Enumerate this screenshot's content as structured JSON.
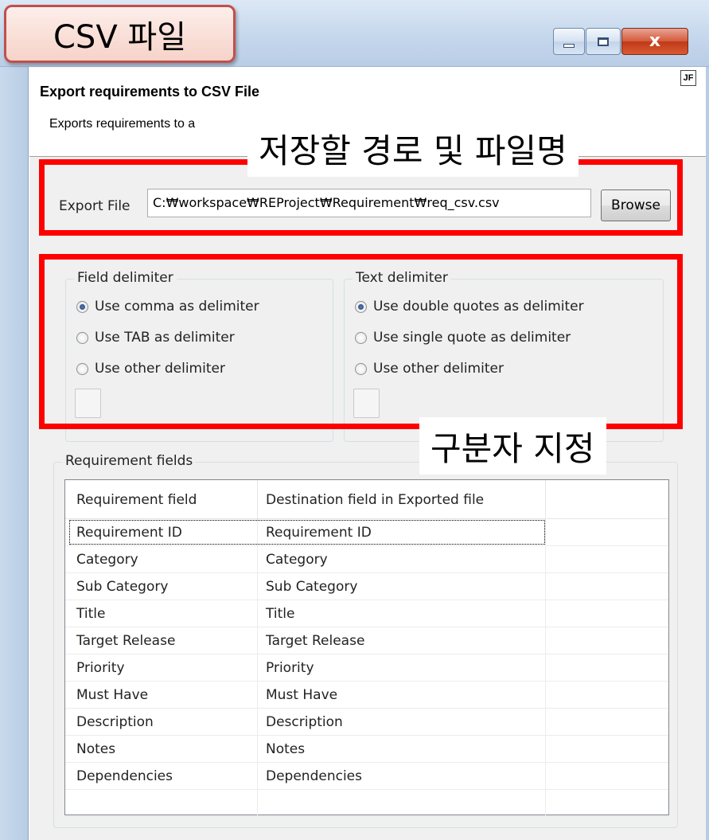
{
  "annotations": {
    "callout_title": "CSV 파일",
    "export_path_label": "저장할 경로 및 파일명",
    "delimiter_label": "구분자 지정"
  },
  "window": {
    "minimize_glyph": "",
    "close_glyph": "x"
  },
  "header": {
    "title": "Export requirements to CSV File",
    "description": "Exports requirements to a",
    "icon_text": "JF"
  },
  "export_file": {
    "label": "Export File",
    "value": "C:\\workspace\\REProject\\Requirement\\req_csv.csv",
    "display_value": "C:₩workspace₩REProject₩Requirement₩req_csv.csv",
    "browse_label": "Browse"
  },
  "field_delimiter": {
    "legend": "Field delimiter",
    "options": [
      {
        "label": "Use comma as delimiter",
        "checked": true
      },
      {
        "label": "Use TAB as delimiter",
        "checked": false
      },
      {
        "label": "Use other delimiter",
        "checked": false
      }
    ],
    "other_value": ""
  },
  "text_delimiter": {
    "legend": "Text delimiter",
    "options": [
      {
        "label": "Use double quotes as delimiter",
        "checked": true
      },
      {
        "label": "Use single quote as delimiter",
        "checked": false
      },
      {
        "label": "Use other delimiter",
        "checked": false
      }
    ],
    "other_value": ""
  },
  "requirement_fields": {
    "legend": "Requirement fields",
    "columns": [
      "Requirement field",
      "Destination field in Exported file"
    ],
    "rows": [
      {
        "field": "Requirement ID",
        "destination": "Requirement ID"
      },
      {
        "field": "Category",
        "destination": "Category"
      },
      {
        "field": "Sub Category",
        "destination": "Sub Category"
      },
      {
        "field": "Title",
        "destination": "Title"
      },
      {
        "field": "Target Release",
        "destination": "Target Release"
      },
      {
        "field": "Priority",
        "destination": "Priority"
      },
      {
        "field": "Must Have",
        "destination": "Must Have"
      },
      {
        "field": "Description",
        "destination": "Description"
      },
      {
        "field": "Notes",
        "destination": "Notes"
      },
      {
        "field": "Dependencies",
        "destination": "Dependencies"
      }
    ]
  },
  "colors": {
    "annotation_red": "#ff0000",
    "callout_border": "#c0504d",
    "radio_checked": "#1e3f78",
    "titlebar": "#c4d6ec"
  }
}
